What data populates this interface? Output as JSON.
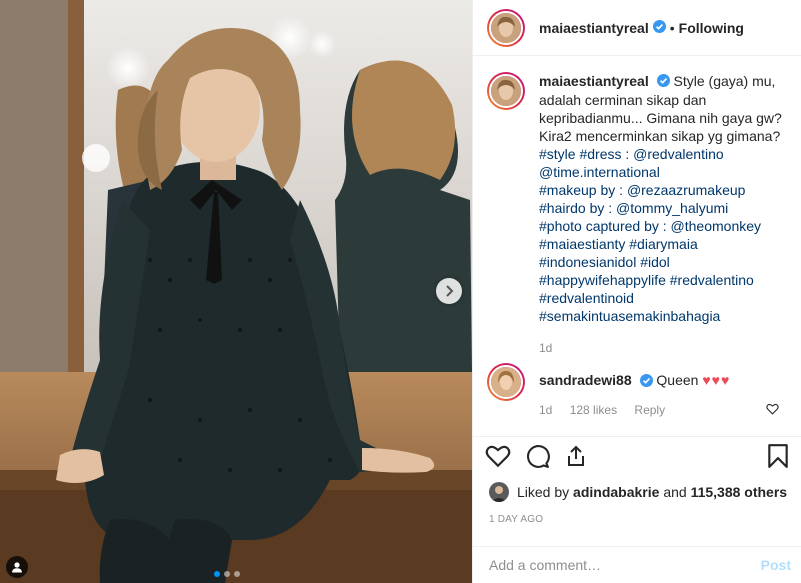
{
  "header": {
    "username": "maiaestiantyreal",
    "separator": "•",
    "follow_state": "Following"
  },
  "caption": {
    "username": "maiaestiantyreal",
    "text": "Style (gaya) mu, adalah cerminan sikap dan kepribadianmu... Gimana nih gaya gw? Kira2 mencerminkan sikap yg gimana?",
    "tags": [
      "#style #dress : @redvalentino",
      "@time.international",
      "#makeup by : @rezaazrumakeup",
      "#hairdo by : @tommy_halyumi",
      "#photo captured by : @theomonkey",
      "#maiaestianty #diarymaia",
      "#indonesianidol #idol",
      "#happywifehappylife #redvalentino",
      "#redvalentinoid",
      "#semakintuasemakinbahagia"
    ],
    "age": "1d"
  },
  "comment": {
    "username": "sandradewi88",
    "text": "Queen",
    "emoji": "♥♥♥",
    "age": "1d",
    "likes": "128 likes",
    "reply": "Reply"
  },
  "likes": {
    "prefix": "Liked by",
    "user": "adindabakrie",
    "middle": "and",
    "count": "115,388 others"
  },
  "timestamp": "1 DAY AGO",
  "add_comment": {
    "placeholder": "Add a comment…",
    "post_label": "Post"
  },
  "icons": {
    "verified": "verified-badge-icon",
    "heart": "heart-icon",
    "comment": "comment-icon",
    "share": "share-icon",
    "save": "bookmark-icon",
    "next": "chevron-right-icon",
    "user_tag": "user-tag-icon"
  },
  "colors": {
    "verified": "#3897f0",
    "link": "#00376b",
    "muted": "#8e8e8e",
    "hearts": "#ed4956",
    "post_disabled": "#b2dffc"
  },
  "carousel": {
    "slides": 3,
    "active": 1
  }
}
